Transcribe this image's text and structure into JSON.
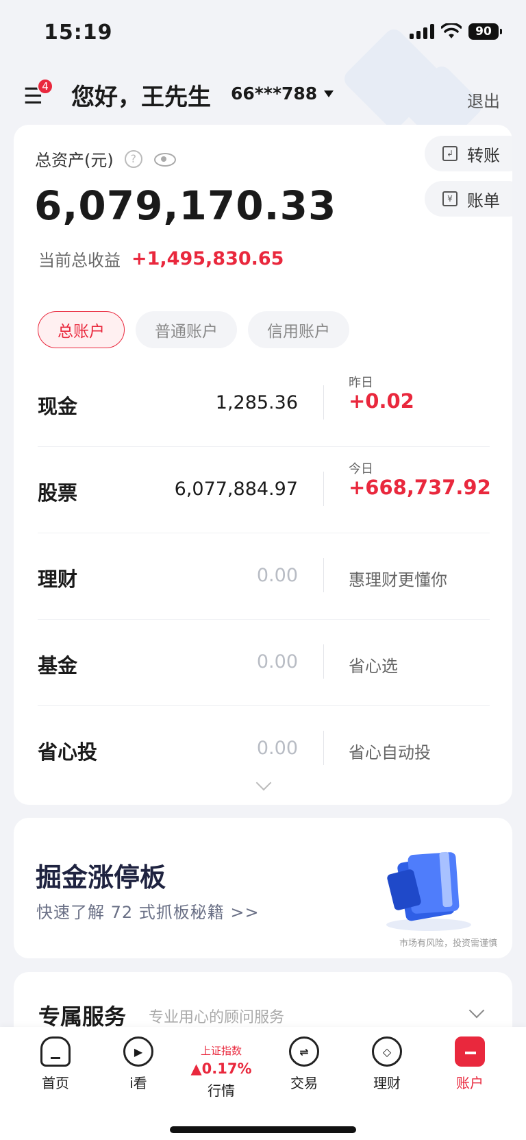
{
  "status_bar": {
    "time": "15:19",
    "battery": "90"
  },
  "header": {
    "notification_count": "4",
    "greeting": "您好，王先生",
    "account_number": "66***788",
    "logout_label": "退出"
  },
  "assets": {
    "label": "总资产(元)",
    "total": "6,079,170.33",
    "income_label": "当前总收益",
    "income_value": "+1,495,830.65",
    "transfer_label": "转账",
    "bill_label": "账单",
    "tabs": [
      {
        "label": "总账户",
        "active": true
      },
      {
        "label": "普通账户",
        "active": false
      },
      {
        "label": "信用账户",
        "active": false
      }
    ],
    "rows": [
      {
        "name": "现金",
        "amount": "1,285.36",
        "sub": "昨日",
        "change": "+0.02",
        "desc": ""
      },
      {
        "name": "股票",
        "amount": "6,077,884.97",
        "sub": "今日",
        "change": "+668,737.92",
        "desc": ""
      },
      {
        "name": "理财",
        "amount": "0.00",
        "sub": "",
        "change": "",
        "desc": "惠理财更懂你"
      },
      {
        "name": "基金",
        "amount": "0.00",
        "sub": "",
        "change": "",
        "desc": "省心选"
      },
      {
        "name": "省心投",
        "amount": "0.00",
        "sub": "",
        "change": "",
        "desc": "省心自动投"
      }
    ]
  },
  "promo": {
    "title": "掘金涨停板",
    "subtitle": "快速了解 72 式抓板秘籍 >>",
    "disclaimer": "市场有风险，投资需谨慎"
  },
  "service": {
    "title": "专属服务",
    "subtitle": "专业用心的顾问服务"
  },
  "bottom_nav": {
    "items": [
      {
        "label": "首页",
        "icon": "home-icon"
      },
      {
        "label": "i看",
        "icon": "play-icon"
      },
      {
        "label": "行情",
        "icon": "market-index"
      },
      {
        "label": "交易",
        "icon": "trade-icon"
      },
      {
        "label": "理财",
        "icon": "finance-icon"
      },
      {
        "label": "账户",
        "icon": "account-icon"
      }
    ],
    "index_name": "上证指数",
    "index_change": "▲0.17%"
  },
  "colors": {
    "accent": "#e9283d",
    "background": "#f2f3f7"
  }
}
